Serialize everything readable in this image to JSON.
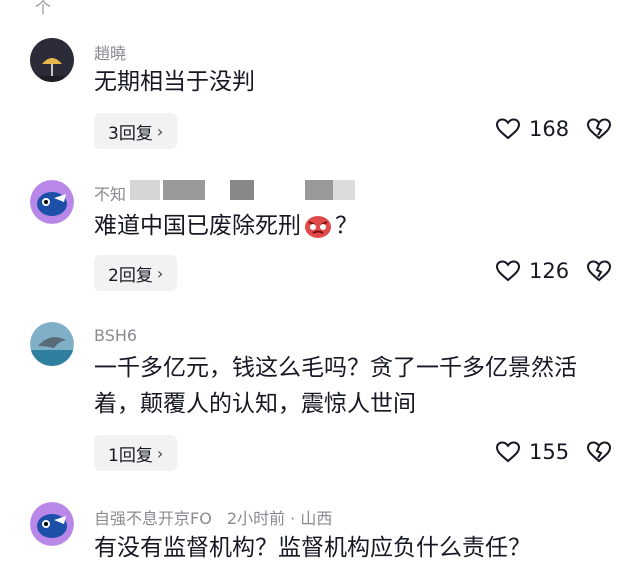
{
  "top_fragment": "个",
  "comments": [
    {
      "username": "趙曉",
      "text": "无期相当于没判",
      "reply_label": "3回复",
      "likes": "168",
      "avatar": "lamp-avatar"
    },
    {
      "username": "不知",
      "text": "难道中国已废除死刑",
      "text_after_emoji": "？",
      "emoji": "angry-face-emoji",
      "reply_label": "2回复",
      "likes": "126",
      "avatar": "cartoon-avatar"
    },
    {
      "username": "BSH6",
      "text": "一千多亿元，钱这么毛吗？贪了一千多亿景然活着，颠覆人的认知，震惊人世间",
      "reply_label": "1回复",
      "likes": "155",
      "avatar": "dolphin-avatar"
    },
    {
      "username": "自强不息开京FO",
      "meta": "2小时前 · 山西",
      "text": "有没有监督机构？监督机构应负什么责任？",
      "avatar": "cartoon-avatar"
    }
  ],
  "colors": {
    "text": "#161823",
    "secondary": "#8a8b91",
    "reply_bg": "#f2f2f2"
  }
}
